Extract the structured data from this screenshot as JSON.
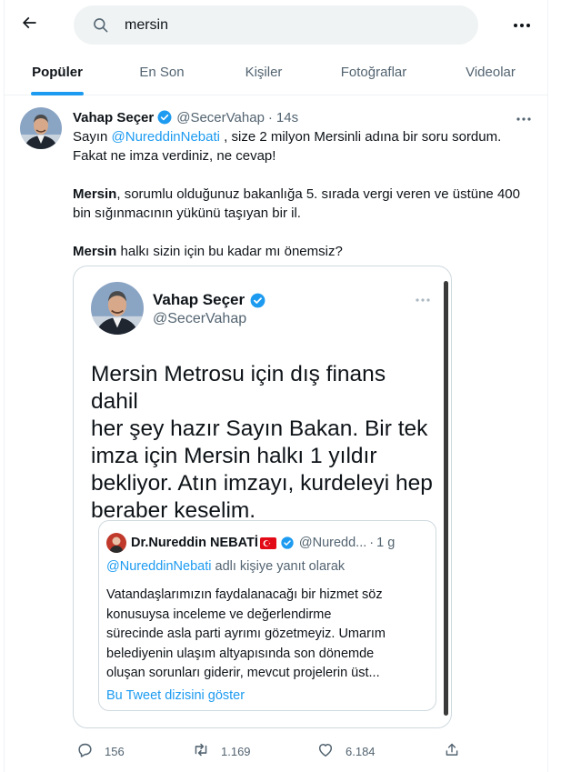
{
  "search": {
    "query": "mersin"
  },
  "tabs": [
    {
      "label": "Popüler",
      "active": true
    },
    {
      "label": "En Son",
      "active": false
    },
    {
      "label": "Kişiler",
      "active": false
    },
    {
      "label": "Fotoğraflar",
      "active": false
    },
    {
      "label": "Videolar",
      "active": false
    }
  ],
  "tweet": {
    "author_name": "Vahap Seçer",
    "handle": "@SecerVahap",
    "separator": "·",
    "time": "14s",
    "text": {
      "l1_pre": "Sayın ",
      "l1_mention": "@NureddinNebati",
      "l1_post": " , size 2 milyon Mersinli adına bir soru sordum.",
      "l2": "Fakat ne imza verdiniz, ne cevap!",
      "p2_kw": "Mersin",
      "p2_rest": ", sorumlu olduğunuz bakanlığa 5. sırada vergi veren ve üstüne 400 bin sığınmacının yükünü taşıyan bir il.",
      "p3_kw": "Mersin",
      "p3_rest": " halkı sizin için bu kadar mı önemsiz?"
    },
    "media": {
      "author_name": "Vahap Seçer",
      "handle": "@SecerVahap",
      "text_lines": [
        "Mersin Metrosu için dış finans dahil",
        "her şey hazır Sayın Bakan. Bir tek",
        "imza için Mersin halkı 1 yıldır",
        "bekliyor. Atın imzayı, kurdeleyi hep",
        "beraber keselim."
      ],
      "quote": {
        "author_name": "Dr.Nureddin NEBATİ",
        "handle": "@Nuredd...",
        "separator": "·",
        "time": "1 g",
        "reply_mention": "@NureddinNebati",
        "reply_suffix": " adlı kişiye yanıt olarak",
        "text_lines": [
          "Vatandaşlarımızın faydalanacağı bir hizmet söz",
          "konusuysa inceleme ve değerlendirme",
          "sürecinde asla parti ayrımı gözetmeyiz. Umarım",
          "belediyenin ulaşım altyapısında son dönemde",
          "oluşan sorunları giderir, mevcut projelerin üst..."
        ],
        "show_thread": "Bu Tweet dizisini göster"
      }
    },
    "actions": {
      "replies": "156",
      "retweets": "1.169",
      "likes": "6.184"
    }
  },
  "colors": {
    "accent": "#1d9bf0",
    "text": "#0f1419",
    "muted": "#536471",
    "border": "#cfd9de"
  }
}
